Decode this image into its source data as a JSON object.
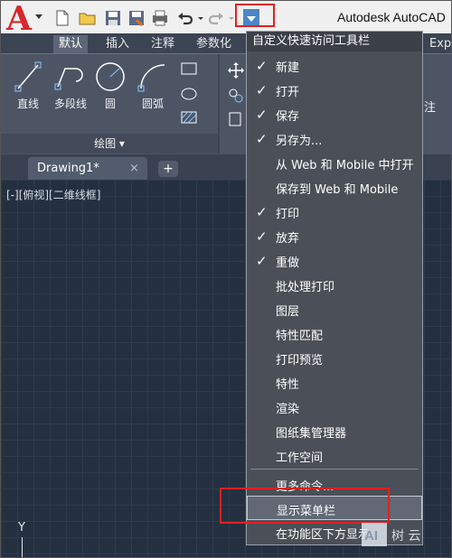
{
  "window": {
    "title": "Autodesk AutoCAD"
  },
  "ribbon": {
    "tabs": [
      "默认",
      "插入",
      "注释",
      "参数化",
      "Exp"
    ],
    "tools": [
      "直线",
      "多段线",
      "圆",
      "圆弧"
    ],
    "panel_label": "绘图",
    "partial_labels": [
      "注"
    ]
  },
  "doc": {
    "tab_title": "Drawing1*",
    "close": "×",
    "new_tab": "+",
    "view_label": "[-][俯视][二维线框]",
    "ucs_y": "Y"
  },
  "menu": {
    "header": "自定义快速访问工具栏",
    "items": [
      {
        "label": "新建",
        "checked": "✓"
      },
      {
        "label": "打开",
        "checked": "✓"
      },
      {
        "label": "保存",
        "checked": "✓"
      },
      {
        "label": "另存为...",
        "checked": "✓"
      },
      {
        "label": "从 Web 和 Mobile 中打开",
        "checked": ""
      },
      {
        "label": "保存到 Web 和 Mobile",
        "checked": ""
      },
      {
        "label": "打印",
        "checked": "✓"
      },
      {
        "label": "放弃",
        "checked": "✓"
      },
      {
        "label": "重做",
        "checked": "✓"
      },
      {
        "label": "批处理打印",
        "checked": ""
      },
      {
        "label": "图层",
        "checked": ""
      },
      {
        "label": "特性匹配",
        "checked": ""
      },
      {
        "label": "打印预览",
        "checked": ""
      },
      {
        "label": "特性",
        "checked": ""
      },
      {
        "label": "渲染",
        "checked": ""
      },
      {
        "label": "图纸集管理器",
        "checked": ""
      },
      {
        "label": "工作空间",
        "checked": ""
      }
    ],
    "more": "更多命令...",
    "show_menubar": "显示菜单栏",
    "below_ribbon": "在功能区下方显示"
  },
  "watermark": {
    "text": "树 云"
  },
  "colors": {
    "accent_red": "#e02020",
    "app_red": "#d8262b",
    "qat_blue": "#4a86c8"
  }
}
